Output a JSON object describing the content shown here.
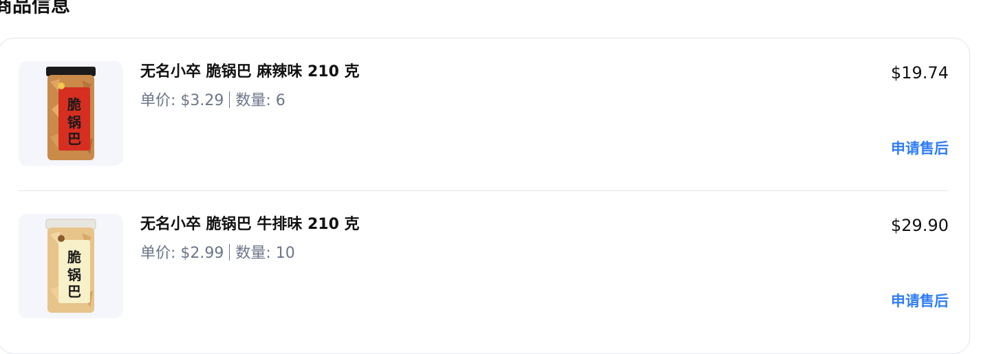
{
  "section": {
    "title": "商品信息"
  },
  "colors": {
    "link": "#2f7cf6",
    "muted": "#6b7588",
    "text": "#111111",
    "thumb_bg": "#f4f6fb"
  },
  "items": [
    {
      "name": "无名小卒 脆锅巴 麻辣味 210 克",
      "unit_price": "单价: $3.29",
      "quantity": "数量: 6",
      "total": "$19.74",
      "action": "申请售后",
      "image": "spicy-crispy-rice-jar"
    },
    {
      "name": "无名小卒 脆锅巴 牛排味 210 克",
      "unit_price": "单价: $2.99",
      "quantity": "数量: 10",
      "total": "$29.90",
      "action": "申请售后",
      "image": "steak-crispy-rice-jar"
    }
  ]
}
